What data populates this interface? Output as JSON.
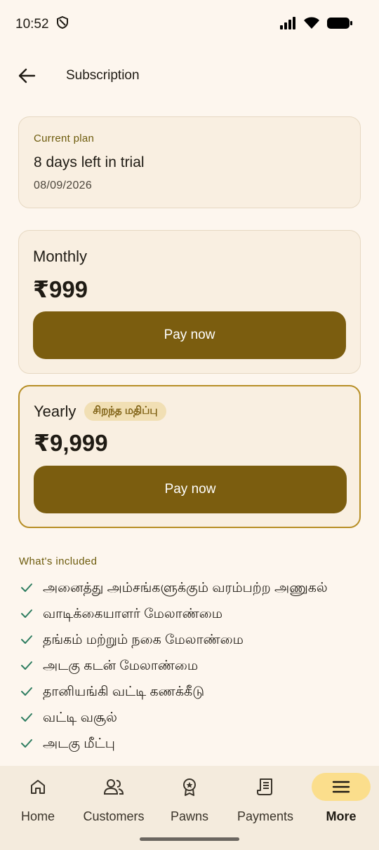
{
  "status_bar": {
    "time": "10:52"
  },
  "header": {
    "title": "Subscription"
  },
  "current_plan": {
    "label": "Current plan",
    "status": "8 days left in trial",
    "date": "08/09/2026"
  },
  "plans": [
    {
      "name": "Monthly",
      "price": "₹999",
      "button": "Pay now"
    },
    {
      "name": "Yearly",
      "badge": "சிறந்த மதிப்பு",
      "price": "₹9,999",
      "button": "Pay now"
    }
  ],
  "included": {
    "label": "What's included",
    "items": [
      "அனைத்து அம்சங்களுக்கும் வரம்பற்ற அணுகல்",
      "வாடிக்கையாளர் மேலாண்மை",
      "தங்கம் மற்றும் நகை மேலாண்மை",
      "அடகு கடன் மேலாண்மை",
      "தானியங்கி வட்டி கணக்கீடு",
      "வட்டி வசூல்",
      "அடகு மீட்பு"
    ]
  },
  "nav": [
    {
      "label": "Home",
      "icon": "home-icon"
    },
    {
      "label": "Customers",
      "icon": "customers-icon"
    },
    {
      "label": "Pawns",
      "icon": "badge-icon"
    },
    {
      "label": "Payments",
      "icon": "receipt-icon"
    },
    {
      "label": "More",
      "icon": "menu-icon",
      "active": true
    }
  ],
  "colors": {
    "accent": "#7b5d0f",
    "background": "#fdf6ee",
    "card": "#f9efe1",
    "check": "#2e7d60",
    "nav_active": "#fbde8c"
  }
}
